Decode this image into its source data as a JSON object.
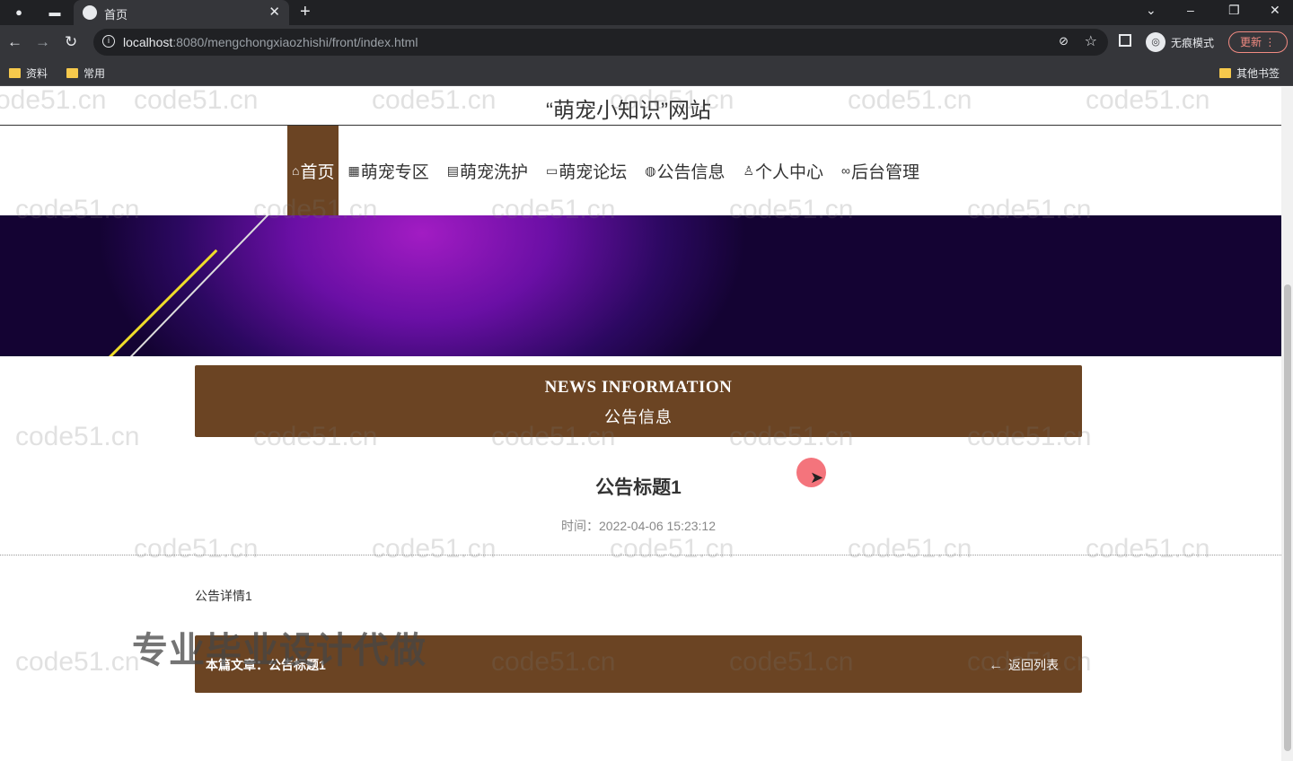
{
  "browser": {
    "tab_title": "首页",
    "url_host": "localhost",
    "url_path": ":8080/mengchongxiaozhishi/front/index.html",
    "incognito_label": "无痕模式",
    "update_label": "更新",
    "bookmarks": [
      "资料",
      "常用"
    ],
    "other_bookmarks": "其他书签"
  },
  "site": {
    "title": "“萌宠小知识”网站",
    "nav": [
      {
        "icon": "⌂",
        "label": "首页"
      },
      {
        "icon": "▦",
        "label": "萌宠专区"
      },
      {
        "icon": "▤",
        "label": "萌宠洗护"
      },
      {
        "icon": "▭",
        "label": "萌宠论坛"
      },
      {
        "icon": "◍",
        "label": "公告信息"
      },
      {
        "icon": "♙",
        "label": "个人中心"
      },
      {
        "icon": "∞",
        "label": "后台管理"
      }
    ]
  },
  "news": {
    "header_en": "NEWS INFORMATION",
    "header_cn": "公告信息",
    "title": "公告标题1",
    "time": "时间：2022-04-06 15:23:12",
    "body": "公告详情1",
    "current_label": "本篇文章：公告标题1",
    "back_label": "返回列表"
  },
  "overlay": {
    "watermark": "code51.cn",
    "promo": "专业毕业设计代做"
  },
  "colors": {
    "accent": "#6b4423"
  }
}
